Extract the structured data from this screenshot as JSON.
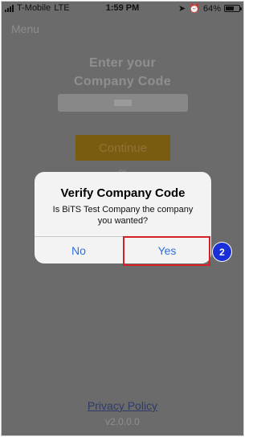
{
  "status_bar": {
    "carrier": "T-Mobile",
    "network": "LTE",
    "time": "1:59 PM",
    "battery": "64%",
    "battery_level": 0.64
  },
  "nav": {
    "menu_label": "Menu"
  },
  "form": {
    "heading_line1": "Enter your",
    "heading_line2": "Company Code",
    "continue_label": "Continue",
    "or_text": "or"
  },
  "dialog": {
    "title": "Verify Company Code",
    "message": "Is BiTS Test Company the company you wanted?",
    "no_label": "No",
    "yes_label": "Yes"
  },
  "annotation": {
    "step_number": "2",
    "highlight_color": "#d62026",
    "badge_color": "#1a2fd8"
  },
  "footer": {
    "privacy_label": "Privacy Policy",
    "version": "v2.0.0.0"
  }
}
